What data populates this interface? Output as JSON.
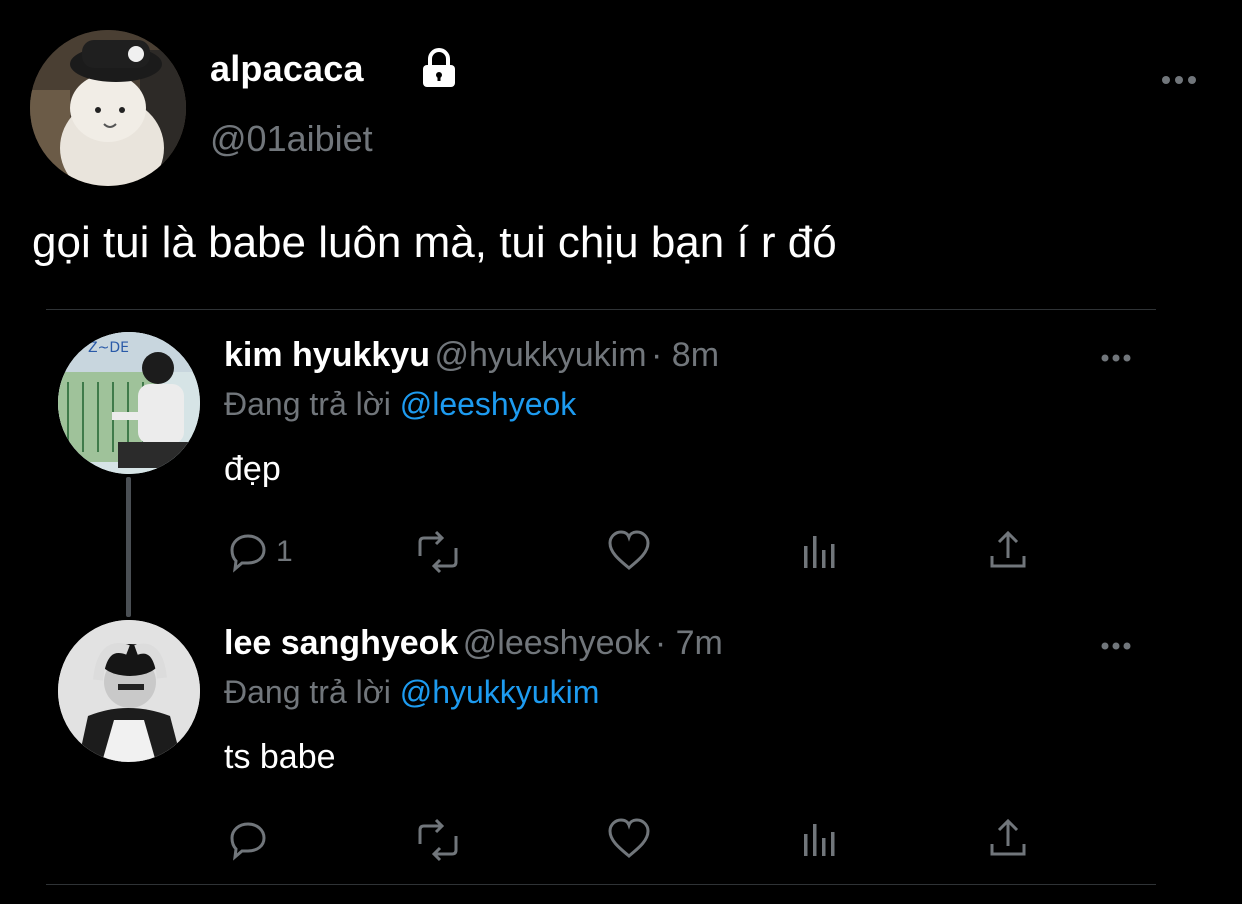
{
  "main_tweet": {
    "display_name": "alpacaca",
    "handle": "@01aibiet",
    "text": "gọi tui là babe luôn mà, tui chịu bạn í r đó"
  },
  "thread": [
    {
      "display_name": "kim hyukkyu",
      "handle": "@hyukkyukim",
      "time": "· 8m",
      "reply_label": "Đang trả lời",
      "reply_to": "@leeshyeok",
      "text": "đẹp",
      "reply_count": "1"
    },
    {
      "display_name": "lee sanghyeok",
      "handle": "@leeshyeok",
      "time": "· 7m",
      "reply_label": "Đang trả lời",
      "reply_to": "@hyukkyukim",
      "text": "ts babe",
      "reply_count": ""
    }
  ],
  "icons": [
    "lock-icon",
    "more-icon",
    "reply-icon",
    "retweet-icon",
    "like-icon",
    "analytics-icon",
    "share-icon"
  ],
  "colors": {
    "background": "#000000",
    "text": "#ffffff",
    "muted": "#71767b",
    "accent": "#1d9bf0",
    "divider": "#2f3336"
  }
}
